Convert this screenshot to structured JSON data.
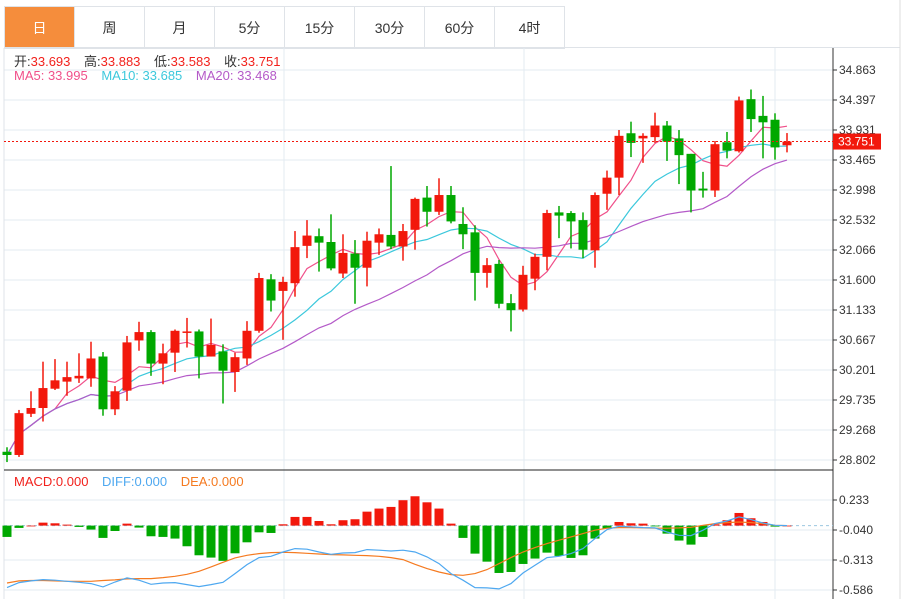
{
  "tabs": [
    {
      "label": "日",
      "active": true
    },
    {
      "label": "周"
    },
    {
      "label": "月"
    },
    {
      "label": "5分"
    },
    {
      "label": "15分"
    },
    {
      "label": "30分"
    },
    {
      "label": "60分"
    },
    {
      "label": "4时"
    }
  ],
  "ohlc": {
    "open_label": "开:",
    "open": "33.693",
    "high_label": "高:",
    "high": "33.883",
    "low_label": "低:",
    "low": "33.583",
    "close_label": "收:",
    "close": "33.751"
  },
  "ma": {
    "ma5": "MA5: 33.995",
    "ma10": "MA10: 33.685",
    "ma20": "MA20: 33.468"
  },
  "macd_legend": {
    "macd": "MACD:0.000",
    "diff": "DIFF:0.000",
    "dea": "DEA:0.000"
  },
  "colors": {
    "active_tab": "#f58d3c",
    "up": "#f2180c",
    "down": "#00a800",
    "ma5": "#f0508a",
    "ma10": "#3cc8dc",
    "ma20": "#b45ac8",
    "diff": "#4ea8f0",
    "dea": "#f57a20"
  },
  "chart_data": [
    {
      "type": "candlestick",
      "price_ticks": [
        "34.863",
        "34.397",
        "33.931",
        "33.465",
        "32.998",
        "32.532",
        "32.066",
        "31.600",
        "31.133",
        "30.667",
        "30.201",
        "29.735",
        "29.268",
        "28.802"
      ],
      "ylim": [
        28.802,
        34.863
      ],
      "last_price": "33.751",
      "candles": [
        [
          28.93,
          29.0,
          28.77,
          28.88
        ],
        [
          28.88,
          29.58,
          28.85,
          29.53
        ],
        [
          29.52,
          29.87,
          29.47,
          29.61
        ],
        [
          29.61,
          30.33,
          29.4,
          29.92
        ],
        [
          29.91,
          30.37,
          29.89,
          30.04
        ],
        [
          30.02,
          30.33,
          29.8,
          30.09
        ],
        [
          30.07,
          30.46,
          30.0,
          30.11
        ],
        [
          30.07,
          30.64,
          29.94,
          30.38
        ],
        [
          30.41,
          30.48,
          29.49,
          29.59
        ],
        [
          29.59,
          29.95,
          29.5,
          29.87
        ],
        [
          29.88,
          30.73,
          29.72,
          30.63
        ],
        [
          30.66,
          30.95,
          30.5,
          30.79
        ],
        [
          30.79,
          30.82,
          30.11,
          30.3
        ],
        [
          30.3,
          30.61,
          29.98,
          30.46
        ],
        [
          30.47,
          30.83,
          30.17,
          30.81
        ],
        [
          30.78,
          31.01,
          30.55,
          30.8
        ],
        [
          30.8,
          30.83,
          30.07,
          30.41
        ],
        [
          30.41,
          31.0,
          30.41,
          30.59
        ],
        [
          30.49,
          30.6,
          29.68,
          30.19
        ],
        [
          30.17,
          30.47,
          29.86,
          30.4
        ],
        [
          30.38,
          30.96,
          30.28,
          30.81
        ],
        [
          30.81,
          31.71,
          30.78,
          31.63
        ],
        [
          31.61,
          31.69,
          31.11,
          31.28
        ],
        [
          31.43,
          31.65,
          30.67,
          31.57
        ],
        [
          31.55,
          32.36,
          31.34,
          32.11
        ],
        [
          32.13,
          32.53,
          31.94,
          32.29
        ],
        [
          32.28,
          32.4,
          31.73,
          32.18
        ],
        [
          32.19,
          32.62,
          31.75,
          31.78
        ],
        [
          31.7,
          32.31,
          31.63,
          32.02
        ],
        [
          32.01,
          32.22,
          31.23,
          31.79
        ],
        [
          31.79,
          32.35,
          31.5,
          32.21
        ],
        [
          32.18,
          32.4,
          31.99,
          32.31
        ],
        [
          32.3,
          33.37,
          32.08,
          32.12
        ],
        [
          32.12,
          32.47,
          31.9,
          32.36
        ],
        [
          32.38,
          32.88,
          32.07,
          32.86
        ],
        [
          32.88,
          33.06,
          32.43,
          32.66
        ],
        [
          32.66,
          33.18,
          32.61,
          32.92
        ],
        [
          32.92,
          33.06,
          32.48,
          32.51
        ],
        [
          32.47,
          32.73,
          32.08,
          32.31
        ],
        [
          32.34,
          32.45,
          31.28,
          31.71
        ],
        [
          31.71,
          31.94,
          31.48,
          31.83
        ],
        [
          31.85,
          31.91,
          31.16,
          31.23
        ],
        [
          31.24,
          31.38,
          30.8,
          31.13
        ],
        [
          31.14,
          31.82,
          31.11,
          31.68
        ],
        [
          31.62,
          32.01,
          31.44,
          31.96
        ],
        [
          31.96,
          32.69,
          31.75,
          32.64
        ],
        [
          32.65,
          32.75,
          32.25,
          32.6
        ],
        [
          32.64,
          32.67,
          32.09,
          32.51
        ],
        [
          32.53,
          32.65,
          31.94,
          32.07
        ],
        [
          32.06,
          32.96,
          31.79,
          32.92
        ],
        [
          32.94,
          33.3,
          32.69,
          33.19
        ],
        [
          33.19,
          33.93,
          32.92,
          33.84
        ],
        [
          33.88,
          34.06,
          33.51,
          33.73
        ],
        [
          33.8,
          33.88,
          33.42,
          33.84
        ],
        [
          33.82,
          34.2,
          33.73,
          34.0
        ],
        [
          34.0,
          34.07,
          33.45,
          33.75
        ],
        [
          33.8,
          33.93,
          33.09,
          33.54
        ],
        [
          33.56,
          33.56,
          32.65,
          32.99
        ],
        [
          33.02,
          33.28,
          32.88,
          32.99
        ],
        [
          32.99,
          33.76,
          32.89,
          33.71
        ],
        [
          33.74,
          33.9,
          33.49,
          33.61
        ],
        [
          33.6,
          34.45,
          33.58,
          34.39
        ],
        [
          34.41,
          34.56,
          33.9,
          34.1
        ],
        [
          34.15,
          34.46,
          33.49,
          34.05
        ],
        [
          34.09,
          34.19,
          33.47,
          33.66
        ],
        [
          33.693,
          33.883,
          33.583,
          33.751
        ]
      ],
      "series": [
        {
          "name": "MA5",
          "period": 5
        },
        {
          "name": "MA10",
          "period": 10
        },
        {
          "name": "MA20",
          "period": 20
        }
      ]
    },
    {
      "type": "bar",
      "macd_ticks": [
        "0.233",
        "-0.040",
        "-0.313",
        "-0.586"
      ],
      "ylim": [
        -0.586,
        0.233
      ],
      "macd": [
        -0.103,
        -0.021,
        0,
        0.027,
        0.021,
        0.009,
        -0.012,
        -0.036,
        -0.112,
        -0.049,
        0.018,
        -0.018,
        -0.097,
        -0.103,
        -0.118,
        -0.188,
        -0.27,
        -0.291,
        -0.321,
        -0.252,
        -0.152,
        -0.061,
        -0.067,
        0.012,
        0.079,
        0.079,
        0.042,
        0.012,
        0.049,
        0.058,
        0.127,
        0.155,
        0.17,
        0.231,
        0.267,
        0.212,
        0.155,
        0.018,
        -0.112,
        -0.255,
        -0.328,
        -0.431,
        -0.422,
        -0.349,
        -0.3,
        -0.246,
        -0.276,
        -0.294,
        -0.27,
        -0.118,
        -0.027,
        0.033,
        0.021,
        0.018,
        -0.003,
        -0.073,
        -0.136,
        -0.173,
        -0.103,
        0.012,
        0.049,
        0.115,
        0.067,
        0.033,
        -0.009,
        0
      ],
      "diff": [
        -0.564,
        -0.519,
        -0.503,
        -0.491,
        -0.497,
        -0.507,
        -0.516,
        -0.528,
        -0.558,
        -0.513,
        -0.476,
        -0.497,
        -0.534,
        -0.522,
        -0.519,
        -0.537,
        -0.555,
        -0.537,
        -0.516,
        -0.437,
        -0.355,
        -0.291,
        -0.279,
        -0.24,
        -0.209,
        -0.215,
        -0.24,
        -0.261,
        -0.249,
        -0.246,
        -0.218,
        -0.224,
        -0.231,
        -0.224,
        -0.24,
        -0.285,
        -0.346,
        -0.437,
        -0.497,
        -0.564,
        -0.567,
        -0.576,
        -0.528,
        -0.431,
        -0.361,
        -0.291,
        -0.279,
        -0.255,
        -0.209,
        -0.118,
        -0.036,
        -0.006,
        -0.012,
        -0.018,
        -0.021,
        -0.058,
        -0.088,
        -0.091,
        -0.042,
        0.018,
        0.042,
        0.079,
        0.055,
        0.024,
        0.003,
        0
      ],
      "dea": [
        -0.522,
        -0.503,
        -0.5,
        -0.5,
        -0.503,
        -0.507,
        -0.507,
        -0.507,
        -0.5,
        -0.494,
        -0.485,
        -0.482,
        -0.482,
        -0.473,
        -0.461,
        -0.443,
        -0.416,
        -0.376,
        -0.334,
        -0.294,
        -0.27,
        -0.255,
        -0.246,
        -0.243,
        -0.246,
        -0.252,
        -0.258,
        -0.264,
        -0.267,
        -0.27,
        -0.273,
        -0.279,
        -0.291,
        -0.309,
        -0.352,
        -0.391,
        -0.422,
        -0.446,
        -0.452,
        -0.437,
        -0.4,
        -0.346,
        -0.291,
        -0.24,
        -0.2,
        -0.164,
        -0.133,
        -0.103,
        -0.073,
        -0.042,
        -0.024,
        -0.018,
        -0.018,
        -0.021,
        -0.024,
        -0.024,
        -0.021,
        -0.015,
        0.003,
        0.018,
        0.027,
        0.033,
        0.027,
        0.018,
        0.003,
        0
      ]
    }
  ]
}
